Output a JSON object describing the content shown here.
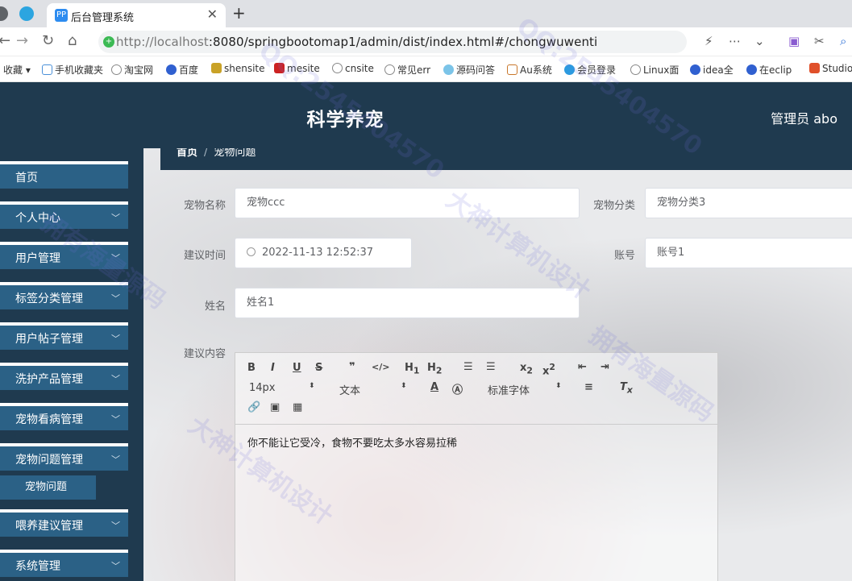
{
  "browser": {
    "tab_title": "后台管理系统",
    "tab_favicon": "PP",
    "url_host": "http://localhost",
    "url_rest": ":8080/springbootomap1/admin/dist/index.html#/chongwuwenti",
    "bookmarks": [
      "收藏",
      "手机收藏夹",
      "淘宝网",
      "百度",
      "shensite",
      "mesite",
      "cnsite",
      "常见err",
      "源码问答",
      "Au系统",
      "会员登录",
      "Linux面",
      "idea全",
      "在eclip",
      "Studio"
    ]
  },
  "app": {
    "title": "科学养宠",
    "user": "管理员 abo"
  },
  "sidebar": {
    "items": [
      {
        "label": "首页",
        "arrow": false
      },
      {
        "label": "个人中心",
        "arrow": true
      },
      {
        "label": "用户管理",
        "arrow": true
      },
      {
        "label": "标签分类管理",
        "arrow": true
      },
      {
        "label": "用户帖子管理",
        "arrow": true
      },
      {
        "label": "洗护产品管理",
        "arrow": true
      },
      {
        "label": "宠物看病管理",
        "arrow": true
      },
      {
        "label": "宠物问题管理",
        "arrow": true
      },
      {
        "label": "喂养建议管理",
        "arrow": true
      },
      {
        "label": "系统管理",
        "arrow": true
      }
    ],
    "sub_item": "宠物问题"
  },
  "breadcrumb": {
    "home": "首页",
    "separator": "/",
    "current": "宠物问题"
  },
  "form": {
    "pet_name_label": "宠物名称",
    "pet_name_value": "宠物ccc",
    "category_label": "宠物分类",
    "category_value": "宠物分类3",
    "time_label": "建议时间",
    "time_value": "2022-11-13 12:52:37",
    "account_label": "账号",
    "account_value": "账号1",
    "name_label": "姓名",
    "name_value": "姓名1",
    "content_label": "建议内容"
  },
  "editor": {
    "font_size": "14px",
    "text_type": "文本",
    "font_family": "标准字体",
    "content": "你不能让它受冷，食物不要吃太多水容易拉稀"
  },
  "watermarks": [
    "QQ:2545404570",
    "大神计算机设计",
    "拥有海量源码"
  ],
  "colors": {
    "header": "#1f3a4f",
    "menu": "#2b6186"
  }
}
